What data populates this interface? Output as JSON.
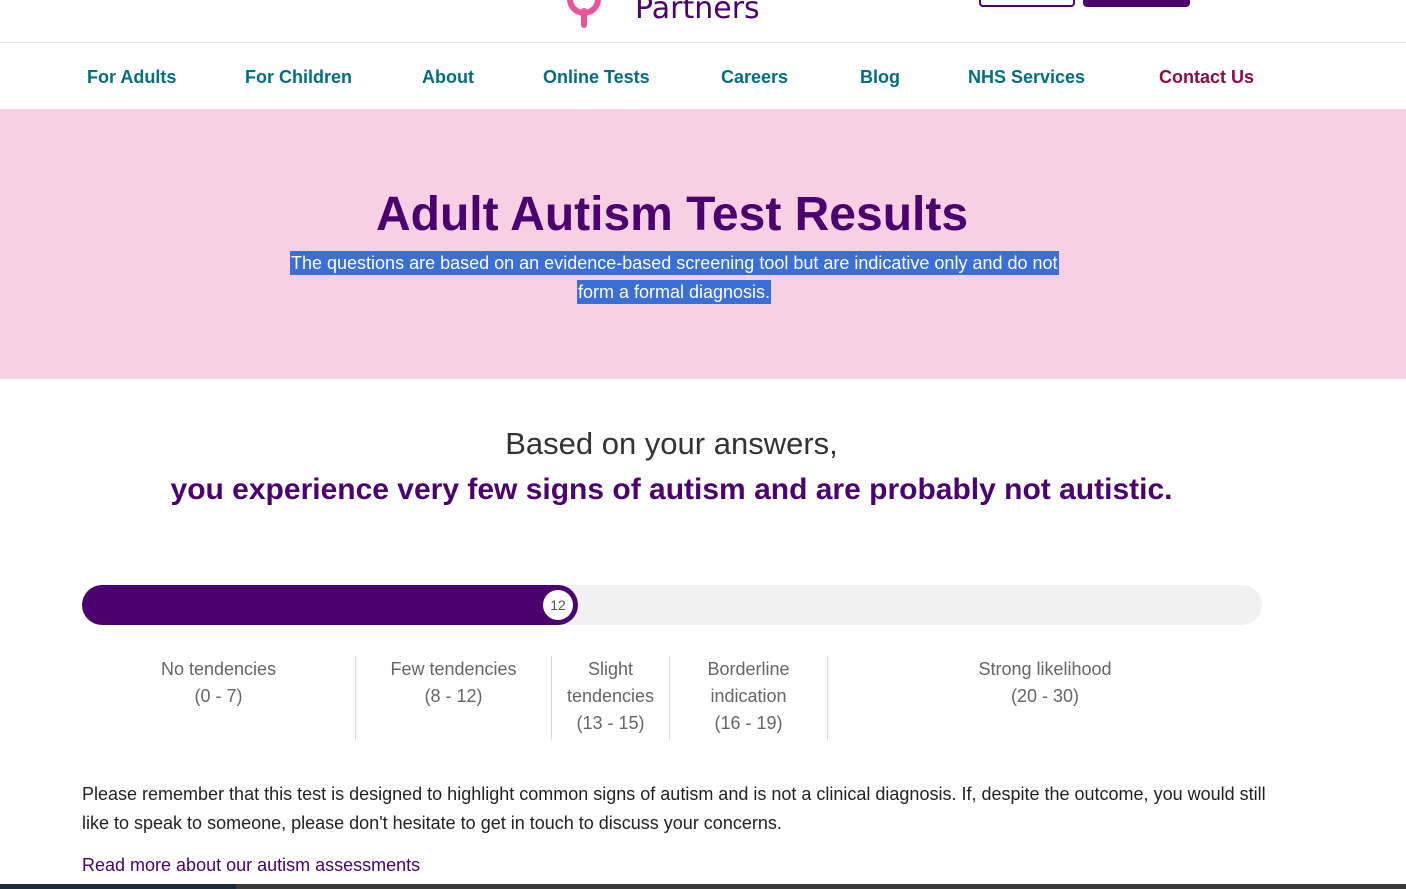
{
  "header": {
    "logo_text": "Partners"
  },
  "nav": {
    "items": [
      {
        "label": "For Adults"
      },
      {
        "label": "For Children"
      },
      {
        "label": "About"
      },
      {
        "label": "Online Tests"
      },
      {
        "label": "Careers"
      },
      {
        "label": "Blog"
      },
      {
        "label": "NHS Services"
      },
      {
        "label": "Contact Us"
      }
    ]
  },
  "hero": {
    "title": "Adult Autism Test Results",
    "subtitle": "The questions are based on an evidence-based screening tool but are indicative only and do not form a formal diagnosis."
  },
  "result": {
    "intro": "Based on your answers,",
    "conclusion": "you experience very few signs of autism and are probably not autistic."
  },
  "score": {
    "value": "12",
    "progress_fraction": 0.42
  },
  "bands": [
    {
      "name": "No tendencies",
      "range": "(0 - 7)"
    },
    {
      "name": "Few tendencies",
      "range": "(8 - 12)"
    },
    {
      "name": "Slight tendencies",
      "range": "(13 - 15)"
    },
    {
      "name": "Borderline indication",
      "range": "(16 - 19)"
    },
    {
      "name": "Strong likelihood",
      "range": "(20 - 30)"
    }
  ],
  "note": {
    "text": "Please remember that this test is designed to highlight common signs of autism and is not a clinical diagnosis. If, despite the outcome, you would still like to speak to someone, please don't hesitate to get in touch to discuss your concerns.",
    "link": "Read more about our autism assessments"
  },
  "colors": {
    "brand_purple": "#4b0070",
    "nav_teal": "#006e7f",
    "contact_maroon": "#8a0a4a",
    "hero_pink": "#f8d0e3",
    "selection_blue": "#3a6fd8",
    "logo_pink": "#e8559a"
  }
}
